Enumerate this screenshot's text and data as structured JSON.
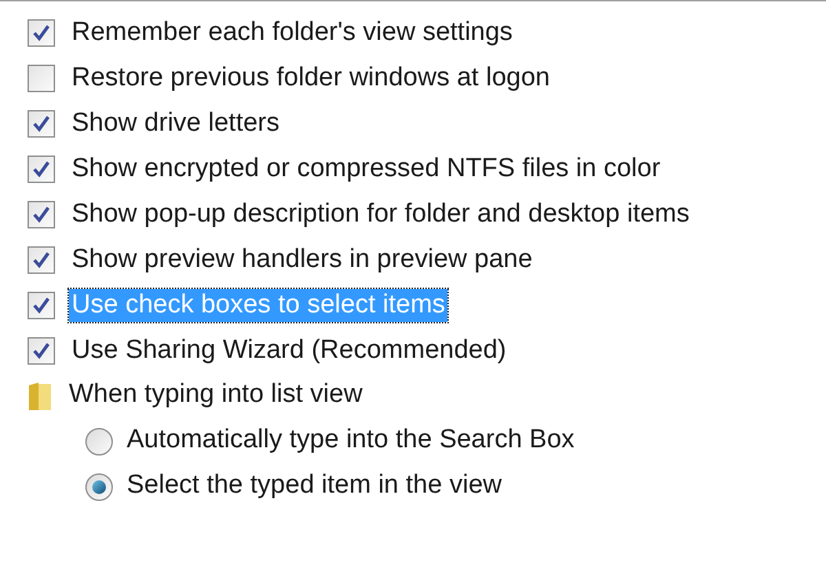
{
  "items": [
    {
      "kind": "checkbox",
      "label": "Remember each folder's view settings",
      "checked": true,
      "selected": false
    },
    {
      "kind": "checkbox",
      "label": "Restore previous folder windows at logon",
      "checked": false,
      "selected": false
    },
    {
      "kind": "checkbox",
      "label": "Show drive letters",
      "checked": true,
      "selected": false
    },
    {
      "kind": "checkbox",
      "label": "Show encrypted or compressed NTFS files in color",
      "checked": true,
      "selected": false
    },
    {
      "kind": "checkbox",
      "label": "Show pop-up description for folder and desktop items",
      "checked": true,
      "selected": false
    },
    {
      "kind": "checkbox",
      "label": "Show preview handlers in preview pane",
      "checked": true,
      "selected": false
    },
    {
      "kind": "checkbox",
      "label": "Use check boxes to select items",
      "checked": true,
      "selected": true
    },
    {
      "kind": "checkbox",
      "label": "Use Sharing Wizard (Recommended)",
      "checked": true,
      "selected": false
    },
    {
      "kind": "folder",
      "label": "When typing into list view",
      "children": [
        {
          "label": "Automatically type into the Search Box",
          "checked": false
        },
        {
          "label": "Select the typed item in the view",
          "checked": true
        }
      ]
    }
  ]
}
